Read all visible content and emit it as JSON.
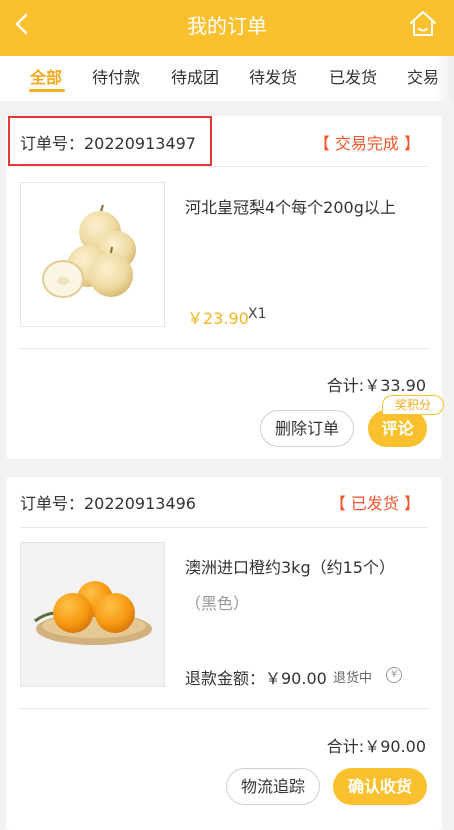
{
  "header": {
    "title": "我的订单",
    "back_icon": "chevron-left-icon",
    "home_icon": "home-icon"
  },
  "tabs": [
    {
      "label": "全部",
      "active": true
    },
    {
      "label": "待付款",
      "active": false
    },
    {
      "label": "待成团",
      "active": false
    },
    {
      "label": "待发货",
      "active": false
    },
    {
      "label": "已发货",
      "active": false
    },
    {
      "label": "交易",
      "active": false
    }
  ],
  "colors": {
    "accent": "#fbc02d",
    "tab_active": "#f3a81c",
    "status": "#f4572a",
    "price": "#f3b61f"
  },
  "orders": [
    {
      "order_no_label": "订单号：20220913497",
      "status": "【 交易完成 】",
      "product": {
        "name": "河北皇冠梨4个每个200g以上",
        "price": "￥23.90",
        "qty": "X1"
      },
      "total": "合计:￥33.90",
      "points_badge": "奖积分",
      "buttons": [
        "删除订单",
        "评论"
      ]
    },
    {
      "order_no_label": "订单号：20220913496",
      "status": "【 已发货 】",
      "product": {
        "name": "澳洲进口橙约3kg（约15个）",
        "variant": "（黑色）",
        "refund_label": "退款金额：￥90.00",
        "refund_status": "退货中",
        "refund_icon": "yen-circle-icon"
      },
      "total": "合计:￥90.00",
      "buttons": [
        "物流追踪",
        "确认收货"
      ]
    }
  ]
}
